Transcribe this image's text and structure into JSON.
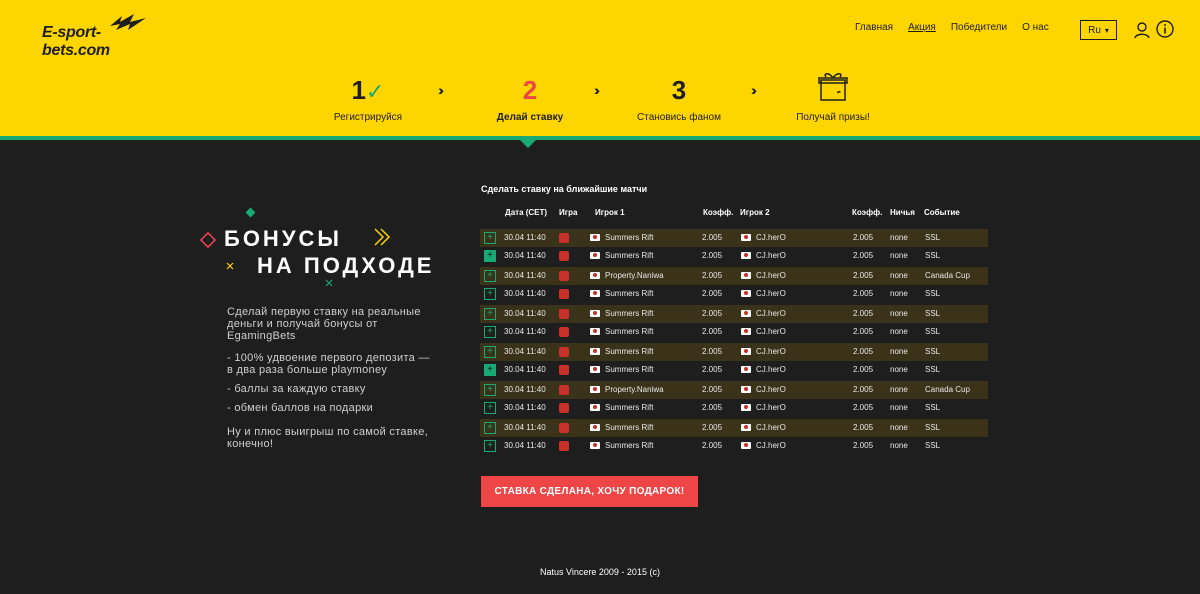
{
  "brand": {
    "logo_text": "E-sport-bets.com",
    "accent": "#ffd500",
    "green": "#19a974",
    "red": "#ee4646"
  },
  "nav": {
    "items": [
      "Главная",
      "Акция",
      "Победители",
      "О нас"
    ],
    "active": "Акция"
  },
  "lang": {
    "value": "Ru"
  },
  "steps": [
    {
      "num": "1",
      "label": "Регистрируйся",
      "done": true
    },
    {
      "num": "2",
      "label": "Делай ставку",
      "current": true
    },
    {
      "num": "3",
      "label": "Становись фаном"
    },
    {
      "num": "",
      "label": "Получай призы!",
      "icon": "gift-icon"
    }
  ],
  "promo": {
    "title_line1": "БОНУСЫ",
    "title_line2": "НА ПОДХОДЕ",
    "intro": "Сделай первую ставку на реальные деньги и получай бонусы от EgamingBets",
    "bullets": [
      "- 100% удвоение первого депозита — в два раза больше playmoney",
      "- баллы за каждую ставку",
      "- обмен баллов на подарки"
    ],
    "outro": "Ну и плюс выигрыш по самой ставке, конечно!"
  },
  "table": {
    "title": "Сделать ставку на ближайшие матчи",
    "headers": {
      "date": "Дата (CET)",
      "game": "Игра",
      "p1": "Игрок 1",
      "k1": "Коэфф.",
      "p2": "Игрок 2",
      "k2": "Коэфф.",
      "draw": "Ничья",
      "event": "Событие"
    },
    "rows": [
      {
        "date": "30.04 11:40",
        "p1": "Summers Rift",
        "k1": "2.005",
        "p2": "CJ.herO",
        "k2": "2.005",
        "draw": "none",
        "event": "SSL"
      },
      {
        "date": "30.04 11:40",
        "p1": "Summers Rift",
        "k1": "2.005",
        "p2": "CJ.herO",
        "k2": "2.005",
        "draw": "none",
        "event": "SSL"
      },
      {
        "date": "30.04 11:40",
        "p1": "Property.Naniwa",
        "k1": "2.005",
        "p2": "CJ.herO",
        "k2": "2.005",
        "draw": "none",
        "event": "Canada Cup"
      },
      {
        "date": "30.04 11:40",
        "p1": "Summers Rift",
        "k1": "2.005",
        "p2": "CJ.herO",
        "k2": "2.005",
        "draw": "none",
        "event": "SSL"
      },
      {
        "date": "30.04 11:40",
        "p1": "Summers Rift",
        "k1": "2.005",
        "p2": "CJ.herO",
        "k2": "2.005",
        "draw": "none",
        "event": "SSL"
      },
      {
        "date": "30.04 11:40",
        "p1": "Summers Rift",
        "k1": "2.005",
        "p2": "CJ.herO",
        "k2": "2.005",
        "draw": "none",
        "event": "SSL"
      },
      {
        "date": "30.04 11:40",
        "p1": "Summers Rift",
        "k1": "2.005",
        "p2": "CJ.herO",
        "k2": "2.005",
        "draw": "none",
        "event": "SSL"
      },
      {
        "date": "30.04 11:40",
        "p1": "Summers Rift",
        "k1": "2.005",
        "p2": "CJ.herO",
        "k2": "2.005",
        "draw": "none",
        "event": "SSL"
      },
      {
        "date": "30.04 11:40",
        "p1": "Property.Naniwa",
        "k1": "2.005",
        "p2": "CJ.herO",
        "k2": "2.005",
        "draw": "none",
        "event": "Canada Cup"
      },
      {
        "date": "30.04 11:40",
        "p1": "Summers Rift",
        "k1": "2.005",
        "p2": "CJ.herO",
        "k2": "2.005",
        "draw": "none",
        "event": "SSL"
      },
      {
        "date": "30.04 11:40",
        "p1": "Summers Rift",
        "k1": "2.005",
        "p2": "CJ.herO",
        "k2": "2.005",
        "draw": "none",
        "event": "SSL"
      },
      {
        "date": "30.04 11:40",
        "p1": "Summers Rift",
        "k1": "2.005",
        "p2": "CJ.herO",
        "k2": "2.005",
        "draw": "none",
        "event": "SSL"
      }
    ]
  },
  "cta": {
    "label": "СТАВКА СДЕЛАНА, ХОЧУ ПОДАРОК!"
  },
  "footer": {
    "text": "Natus Vincere  2009 - 2015 (c)"
  }
}
